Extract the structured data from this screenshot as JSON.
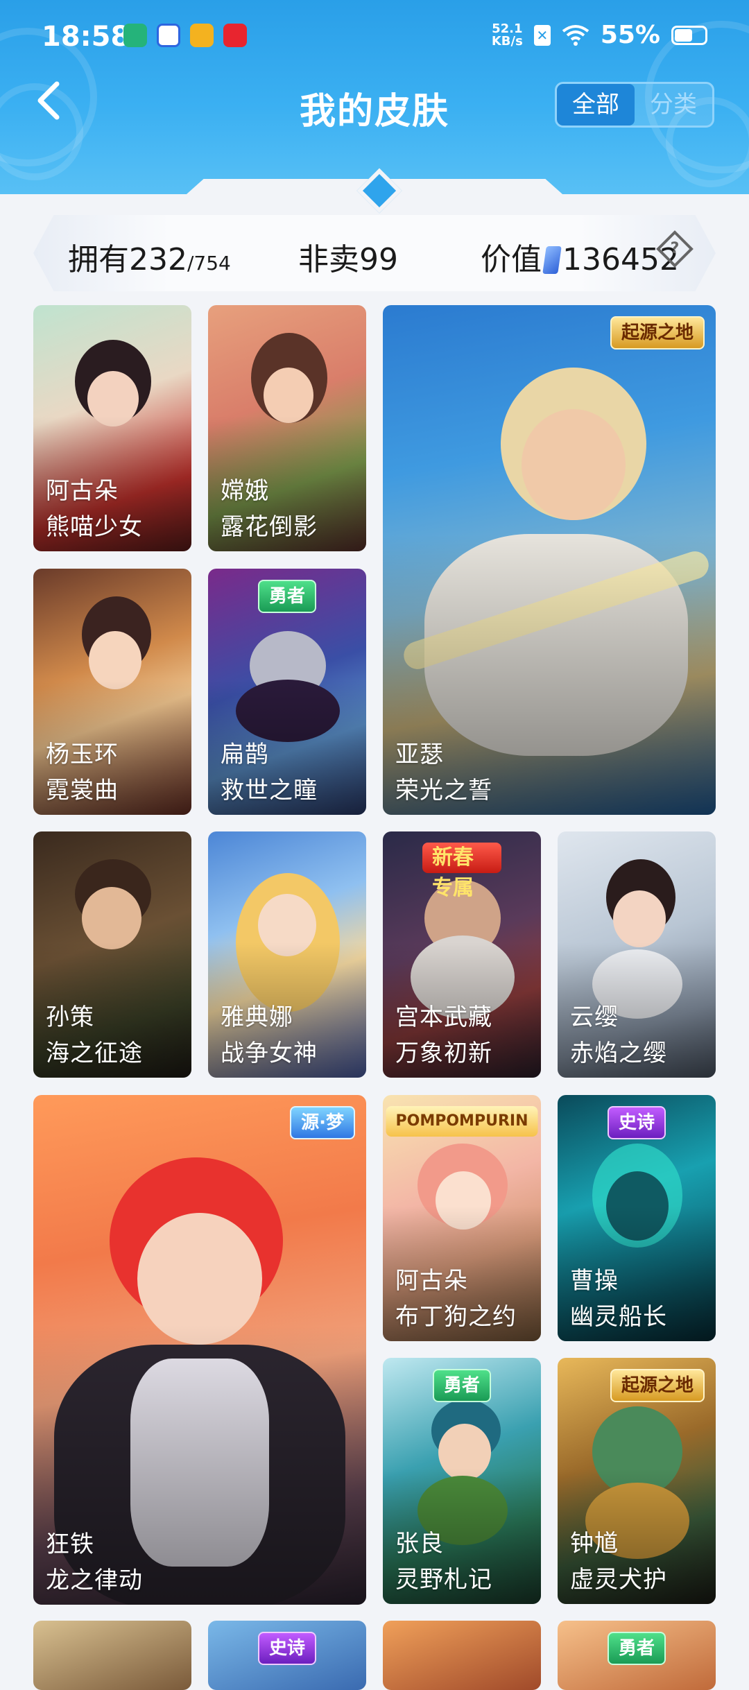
{
  "status_bar": {
    "time": "18:58",
    "net_speed_value": "52.1",
    "net_speed_unit": "KB/s",
    "battery": "55%",
    "battery_level": 0.55,
    "app_icons": [
      "app-icon-1",
      "app-icon-2",
      "app-icon-3",
      "app-icon-4"
    ]
  },
  "header": {
    "title": "我的皮肤",
    "tab_all": "全部",
    "tab_category": "分类"
  },
  "stats": {
    "own_label": "拥有",
    "own_count": "232",
    "own_total": "/754",
    "not_for_sale_label": "非卖",
    "not_for_sale_count": "99",
    "value_label": "价值",
    "value_amount": "136452"
  },
  "skins": [
    {
      "hero": "阿古朵",
      "skin": "熊喵少女",
      "tag": ""
    },
    {
      "hero": "嫦娥",
      "skin": "露花倒影",
      "tag": ""
    },
    {
      "hero": "亚瑟",
      "skin": "荣光之誓",
      "tag": "起源之地"
    },
    {
      "hero": "杨玉环",
      "skin": "霓裳曲",
      "tag": ""
    },
    {
      "hero": "扁鹊",
      "skin": "救世之瞳",
      "tag": "勇者"
    },
    {
      "hero": "孙策",
      "skin": "海之征途",
      "tag": ""
    },
    {
      "hero": "雅典娜",
      "skin": "战争女神",
      "tag": ""
    },
    {
      "hero": "宫本武藏",
      "skin": "万象初新",
      "tag": "新春专属"
    },
    {
      "hero": "云缨",
      "skin": "赤焰之缨",
      "tag": ""
    },
    {
      "hero": "狂铁",
      "skin": "龙之律动",
      "tag": "源·梦"
    },
    {
      "hero": "阿古朵",
      "skin": "布丁狗之约",
      "tag": "POMPOMPURIN"
    },
    {
      "hero": "曹操",
      "skin": "幽灵船长",
      "tag": "史诗"
    },
    {
      "hero": "张良",
      "skin": "灵野札记",
      "tag": "勇者"
    },
    {
      "hero": "钟馗",
      "skin": "虚灵犬护",
      "tag": "起源之地"
    }
  ],
  "partial_row_tags": [
    "",
    "史诗",
    "",
    "勇者"
  ],
  "colors": {
    "header_blue": "#2a9fe8",
    "background": "#f2f4f8",
    "tab_active": "#1e86d8"
  }
}
